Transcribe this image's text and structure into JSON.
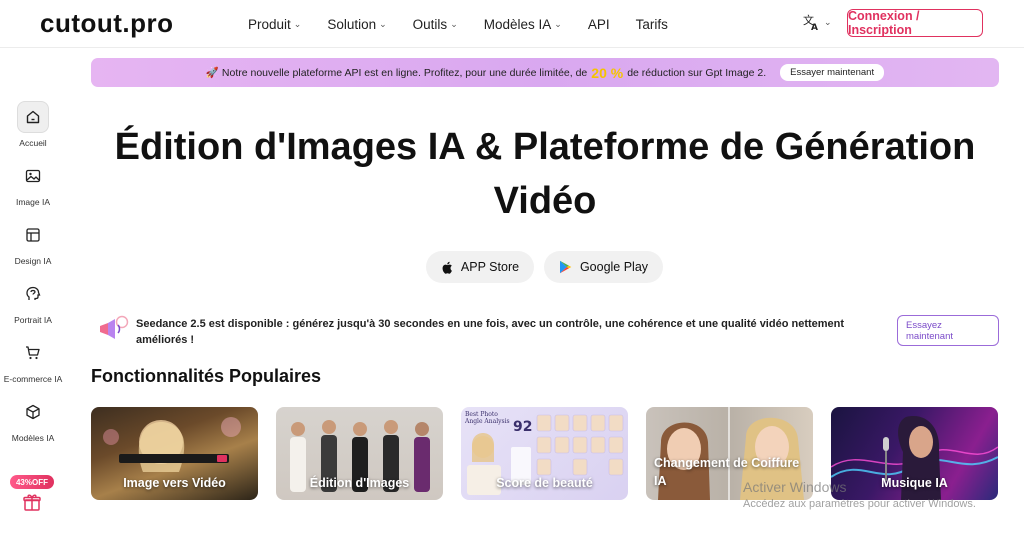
{
  "header": {
    "logo": "cutout.pro",
    "nav": [
      {
        "label": "Produit",
        "caret": true
      },
      {
        "label": "Solution",
        "caret": true
      },
      {
        "label": "Outils",
        "caret": true
      },
      {
        "label": "Modèles IA",
        "caret": true
      },
      {
        "label": "API",
        "caret": false
      },
      {
        "label": "Tarifs",
        "caret": false
      }
    ],
    "lang_icon": "translate-icon",
    "login_label": "Connexion / Inscription"
  },
  "sidebar": {
    "items": [
      {
        "label": "Accueil",
        "icon": "home-icon"
      },
      {
        "label": "Image IA",
        "icon": "image-icon"
      },
      {
        "label": "Design IA",
        "icon": "layout-icon"
      },
      {
        "label": "Portrait IA",
        "icon": "portrait-icon"
      },
      {
        "label": "E-commerce IA",
        "icon": "cart-icon"
      },
      {
        "label": "Modèles IA",
        "icon": "cube-icon"
      }
    ],
    "promo_badge": "43%OFF",
    "gift_icon": "gift-icon"
  },
  "banner": {
    "text_before": "🚀 Notre nouvelle plateforme API est en ligne. Profitez, pour une durée limitée, de",
    "percent": "20 %",
    "text_after": "de réduction sur Gpt Image 2.",
    "button": "Essayer maintenant"
  },
  "hero": {
    "title_line1": "Édition d'Images IA & Plateforme de Génération",
    "title_line2": "Vidéo",
    "app_store": "APP Store",
    "google_play": "Google Play"
  },
  "notice": {
    "text": "Seedance 2.5 est disponible : générez jusqu'à 30 secondes en une fois, avec un contrôle, une cohérence et une qualité vidéo nettement améliorés !",
    "button_line1": "Essayez",
    "button_line2": "maintenant"
  },
  "features": {
    "title": "Fonctionnalités Populaires",
    "cards": [
      {
        "label": "Image vers Vidéo"
      },
      {
        "label": "Édition d'Images"
      },
      {
        "label": "Score de beauté"
      },
      {
        "label": "Changement de Coiffure IA"
      },
      {
        "label": "Musique IA"
      }
    ],
    "score_card_text": "Best Photo Angle Analysis",
    "score_value": "92"
  },
  "watermark": {
    "line1": "Activer Windows",
    "line2": "Accédez aux paramètres pour activer Windows."
  },
  "colors": {
    "brand": "#e0315f",
    "accent_purple": "#7b4bc9",
    "banner_bg": "#dcaaf0",
    "percent": "#f5c400"
  }
}
